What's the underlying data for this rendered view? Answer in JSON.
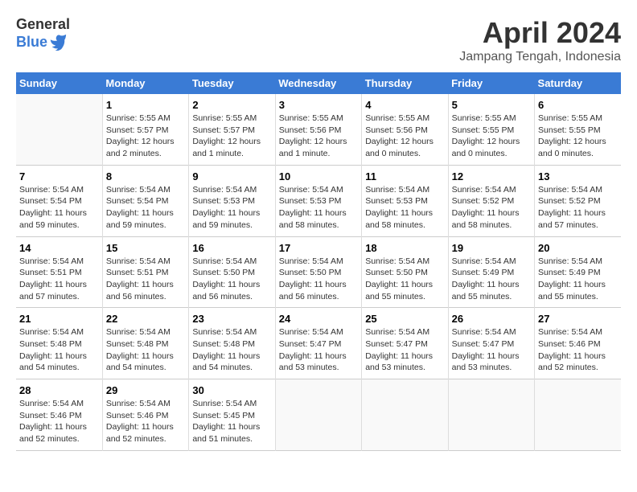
{
  "logo": {
    "general": "General",
    "blue": "Blue"
  },
  "title": "April 2024",
  "location": "Jampang Tengah, Indonesia",
  "weekdays": [
    "Sunday",
    "Monday",
    "Tuesday",
    "Wednesday",
    "Thursday",
    "Friday",
    "Saturday"
  ],
  "weeks": [
    [
      {
        "day": "",
        "info": ""
      },
      {
        "day": "1",
        "info": "Sunrise: 5:55 AM\nSunset: 5:57 PM\nDaylight: 12 hours\nand 2 minutes."
      },
      {
        "day": "2",
        "info": "Sunrise: 5:55 AM\nSunset: 5:57 PM\nDaylight: 12 hours\nand 1 minute."
      },
      {
        "day": "3",
        "info": "Sunrise: 5:55 AM\nSunset: 5:56 PM\nDaylight: 12 hours\nand 1 minute."
      },
      {
        "day": "4",
        "info": "Sunrise: 5:55 AM\nSunset: 5:56 PM\nDaylight: 12 hours\nand 0 minutes."
      },
      {
        "day": "5",
        "info": "Sunrise: 5:55 AM\nSunset: 5:55 PM\nDaylight: 12 hours\nand 0 minutes."
      },
      {
        "day": "6",
        "info": "Sunrise: 5:55 AM\nSunset: 5:55 PM\nDaylight: 12 hours\nand 0 minutes."
      }
    ],
    [
      {
        "day": "7",
        "info": "Sunrise: 5:54 AM\nSunset: 5:54 PM\nDaylight: 11 hours\nand 59 minutes."
      },
      {
        "day": "8",
        "info": "Sunrise: 5:54 AM\nSunset: 5:54 PM\nDaylight: 11 hours\nand 59 minutes."
      },
      {
        "day": "9",
        "info": "Sunrise: 5:54 AM\nSunset: 5:53 PM\nDaylight: 11 hours\nand 59 minutes."
      },
      {
        "day": "10",
        "info": "Sunrise: 5:54 AM\nSunset: 5:53 PM\nDaylight: 11 hours\nand 58 minutes."
      },
      {
        "day": "11",
        "info": "Sunrise: 5:54 AM\nSunset: 5:53 PM\nDaylight: 11 hours\nand 58 minutes."
      },
      {
        "day": "12",
        "info": "Sunrise: 5:54 AM\nSunset: 5:52 PM\nDaylight: 11 hours\nand 58 minutes."
      },
      {
        "day": "13",
        "info": "Sunrise: 5:54 AM\nSunset: 5:52 PM\nDaylight: 11 hours\nand 57 minutes."
      }
    ],
    [
      {
        "day": "14",
        "info": "Sunrise: 5:54 AM\nSunset: 5:51 PM\nDaylight: 11 hours\nand 57 minutes."
      },
      {
        "day": "15",
        "info": "Sunrise: 5:54 AM\nSunset: 5:51 PM\nDaylight: 11 hours\nand 56 minutes."
      },
      {
        "day": "16",
        "info": "Sunrise: 5:54 AM\nSunset: 5:50 PM\nDaylight: 11 hours\nand 56 minutes."
      },
      {
        "day": "17",
        "info": "Sunrise: 5:54 AM\nSunset: 5:50 PM\nDaylight: 11 hours\nand 56 minutes."
      },
      {
        "day": "18",
        "info": "Sunrise: 5:54 AM\nSunset: 5:50 PM\nDaylight: 11 hours\nand 55 minutes."
      },
      {
        "day": "19",
        "info": "Sunrise: 5:54 AM\nSunset: 5:49 PM\nDaylight: 11 hours\nand 55 minutes."
      },
      {
        "day": "20",
        "info": "Sunrise: 5:54 AM\nSunset: 5:49 PM\nDaylight: 11 hours\nand 55 minutes."
      }
    ],
    [
      {
        "day": "21",
        "info": "Sunrise: 5:54 AM\nSunset: 5:48 PM\nDaylight: 11 hours\nand 54 minutes."
      },
      {
        "day": "22",
        "info": "Sunrise: 5:54 AM\nSunset: 5:48 PM\nDaylight: 11 hours\nand 54 minutes."
      },
      {
        "day": "23",
        "info": "Sunrise: 5:54 AM\nSunset: 5:48 PM\nDaylight: 11 hours\nand 54 minutes."
      },
      {
        "day": "24",
        "info": "Sunrise: 5:54 AM\nSunset: 5:47 PM\nDaylight: 11 hours\nand 53 minutes."
      },
      {
        "day": "25",
        "info": "Sunrise: 5:54 AM\nSunset: 5:47 PM\nDaylight: 11 hours\nand 53 minutes."
      },
      {
        "day": "26",
        "info": "Sunrise: 5:54 AM\nSunset: 5:47 PM\nDaylight: 11 hours\nand 53 minutes."
      },
      {
        "day": "27",
        "info": "Sunrise: 5:54 AM\nSunset: 5:46 PM\nDaylight: 11 hours\nand 52 minutes."
      }
    ],
    [
      {
        "day": "28",
        "info": "Sunrise: 5:54 AM\nSunset: 5:46 PM\nDaylight: 11 hours\nand 52 minutes."
      },
      {
        "day": "29",
        "info": "Sunrise: 5:54 AM\nSunset: 5:46 PM\nDaylight: 11 hours\nand 52 minutes."
      },
      {
        "day": "30",
        "info": "Sunrise: 5:54 AM\nSunset: 5:45 PM\nDaylight: 11 hours\nand 51 minutes."
      },
      {
        "day": "",
        "info": ""
      },
      {
        "day": "",
        "info": ""
      },
      {
        "day": "",
        "info": ""
      },
      {
        "day": "",
        "info": ""
      }
    ]
  ]
}
